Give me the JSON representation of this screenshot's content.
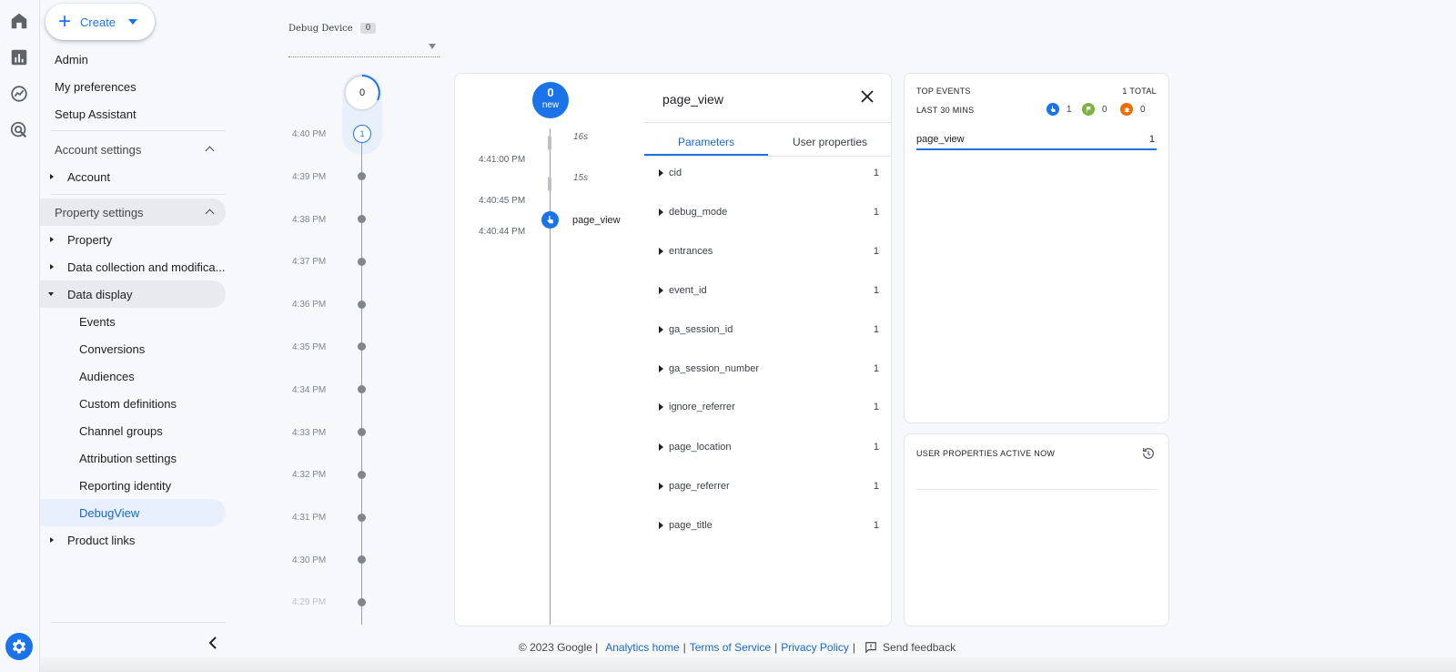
{
  "rail": {
    "icons": [
      "home-icon",
      "reports-icon",
      "explore-icon",
      "advertising-icon",
      "admin-gear-icon"
    ]
  },
  "nav": {
    "create_label": "Create",
    "items": {
      "admin": "Admin",
      "prefs": "My preferences",
      "setup": "Setup Assistant",
      "account_settings": "Account settings",
      "account": "Account",
      "property_settings": "Property settings",
      "property": "Property",
      "data_collection": "Data collection and modifica...",
      "data_display": "Data display",
      "events": "Events",
      "conversions": "Conversions",
      "audiences": "Audiences",
      "custom_definitions": "Custom definitions",
      "channel_groups": "Channel groups",
      "attribution_settings": "Attribution settings",
      "reporting_identity": "Reporting identity",
      "debugview": "DebugView",
      "product_links": "Product links"
    }
  },
  "debug_device": {
    "label": "Debug Device",
    "count": "0"
  },
  "minutes": {
    "top_count": "0",
    "current_count": "1",
    "labels": [
      "4:40 PM",
      "4:39 PM",
      "4:38 PM",
      "4:37 PM",
      "4:36 PM",
      "4:35 PM",
      "4:34 PM",
      "4:33 PM",
      "4:32 PM",
      "4:31 PM",
      "4:30 PM",
      "4:29 PM"
    ]
  },
  "stream": {
    "new_count": "0",
    "new_label": "new",
    "gaps": [
      "16s",
      "15s"
    ],
    "times": [
      "4:41:00 PM",
      "4:40:45 PM",
      "4:40:44 PM"
    ],
    "event_name": "page_view"
  },
  "params": {
    "title": "page_view",
    "tabs": [
      "Parameters",
      "User properties"
    ],
    "rows": [
      {
        "name": "cid",
        "count": "1"
      },
      {
        "name": "debug_mode",
        "count": "1"
      },
      {
        "name": "entrances",
        "count": "1"
      },
      {
        "name": "event_id",
        "count": "1"
      },
      {
        "name": "ga_session_id",
        "count": "1"
      },
      {
        "name": "ga_session_number",
        "count": "1"
      },
      {
        "name": "ignore_referrer",
        "count": "1"
      },
      {
        "name": "page_location",
        "count": "1"
      },
      {
        "name": "page_referrer",
        "count": "1"
      },
      {
        "name": "page_title",
        "count": "1"
      }
    ]
  },
  "top_events": {
    "title": "TOP EVENTS",
    "total": "1 TOTAL",
    "subtitle": "LAST 30 MINS",
    "counts": {
      "events": "1",
      "conversions": "0",
      "errors": "0"
    },
    "event": "page_view",
    "event_count": "1"
  },
  "user_props": {
    "title": "USER PROPERTIES ACTIVE NOW"
  },
  "footer": {
    "copyright": "© 2023 Google |",
    "analytics_home": "Analytics home",
    "terms": "Terms of Service",
    "privacy": "Privacy Policy",
    "feedback": "Send feedback"
  },
  "colors": {
    "accent": "#1a73e8",
    "active_bg": "#e8f0fe",
    "conversion": "#7cb342",
    "error": "#ef6c00"
  }
}
